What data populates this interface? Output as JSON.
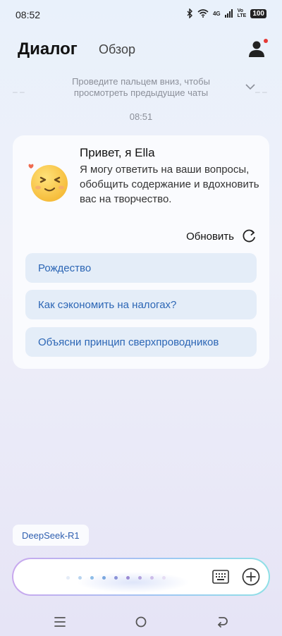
{
  "status_bar": {
    "time": "08:52",
    "network_label": "4G",
    "volte_label": "Vo\nLTE",
    "battery_level": "100"
  },
  "header": {
    "tab_dialog": "Диалог",
    "tab_overview": "Обзор"
  },
  "hint": {
    "line1": "Проведите пальцем вниз, чтобы",
    "line2": "просмотреть предыдущие чаты"
  },
  "timestamp": "08:51",
  "greeting": {
    "title": "Привет, я Ella",
    "text": "Я могу ответить на ваши вопросы, обобщить содержание и вдохновить вас на творчество."
  },
  "refresh_label": "Обновить",
  "suggestions": [
    "Рождество",
    "Как сэкономить на налогах?",
    "Объясни принцип сверхпроводников"
  ],
  "model_chip": "DeepSeek-R1",
  "colors": {
    "accent": "#2c66b5",
    "suggestion_bg": "#e4edf8",
    "notification_dot": "#e53935"
  }
}
